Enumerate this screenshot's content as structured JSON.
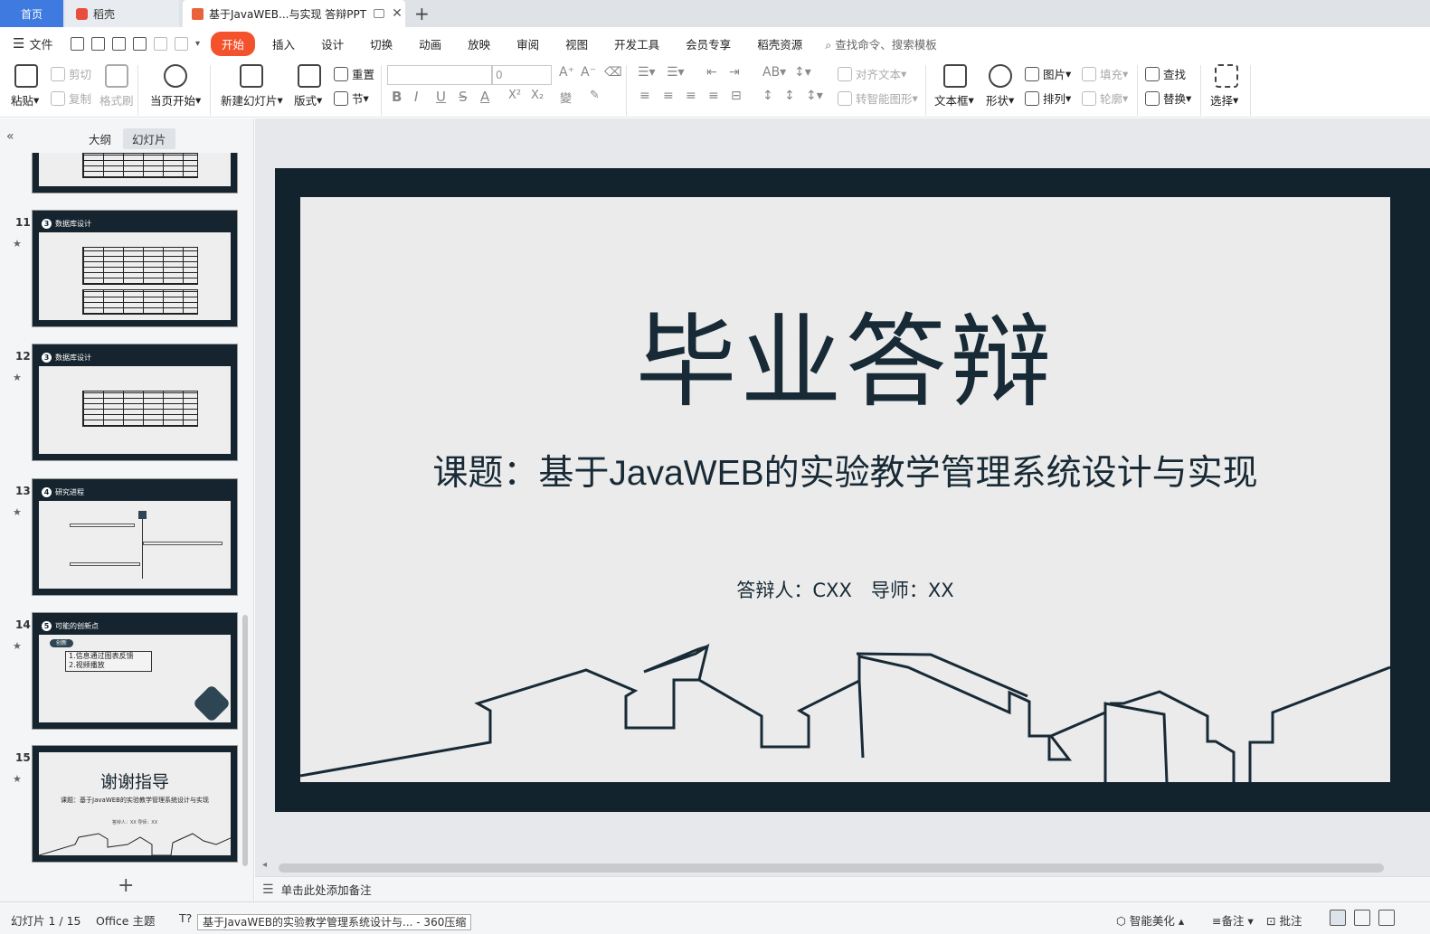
{
  "tabs": {
    "home": "首页",
    "daoke": "稻壳",
    "doc": "基于JavaWEB...与实现 答辩PPT"
  },
  "menu": {
    "file": "文件",
    "items": [
      "开始",
      "插入",
      "设计",
      "切换",
      "动画",
      "放映",
      "审阅",
      "视图",
      "开发工具",
      "会员专享",
      "稻壳资源"
    ],
    "search": "查找命令、搜索模板"
  },
  "ribbon": {
    "paste": "粘贴",
    "cut": "剪切",
    "copy": "复制",
    "format_painter": "格式刷",
    "from_current": "当页开始",
    "new_slide": "新建幻灯片",
    "layout": "版式",
    "reset": "重置",
    "section": "节",
    "font_size": "0",
    "align_text": "对齐文本",
    "smart_shape": "转智能图形",
    "textbox": "文本框",
    "shape": "形状",
    "picture": "图片",
    "arrange": "排列",
    "fill": "填充",
    "outline": "轮廓",
    "find": "查找",
    "replace": "替换",
    "select": "选择"
  },
  "panel": {
    "outline_tab": "大纲",
    "slides_tab": "幻灯片",
    "thumbs": [
      {
        "num": "11",
        "badge": "3",
        "title": "数据库设计"
      },
      {
        "num": "12",
        "badge": "3",
        "title": "数据库设计"
      },
      {
        "num": "13",
        "badge": "4",
        "title": "研究进程"
      },
      {
        "num": "14",
        "badge": "5",
        "title": "可能的创新点",
        "pill": "创新",
        "line1": "1.信息通过图表反馈",
        "line2": "2.视频播放"
      },
      {
        "num": "15",
        "title": "谢谢指导",
        "sub": "课题：基于JavaWEB的实验教学管理系统设计与实现",
        "by": "答辩人：XX 导师：XX"
      }
    ]
  },
  "slide": {
    "title": "毕业答辩",
    "subtitle": "课题：基于JavaWEB的实验教学管理系统设计与实现",
    "presenter": "答辩人：CXX　导师：XX"
  },
  "notes_placeholder": "单击此处添加备注",
  "status": {
    "slide_count": "幻灯片 1 / 15",
    "theme": "Office 主题",
    "tooltip": "基于JavaWEB的实验教学管理系统设计与... - 360压缩",
    "beautify": "智能美化",
    "notes": "备注",
    "comments": "批注"
  }
}
